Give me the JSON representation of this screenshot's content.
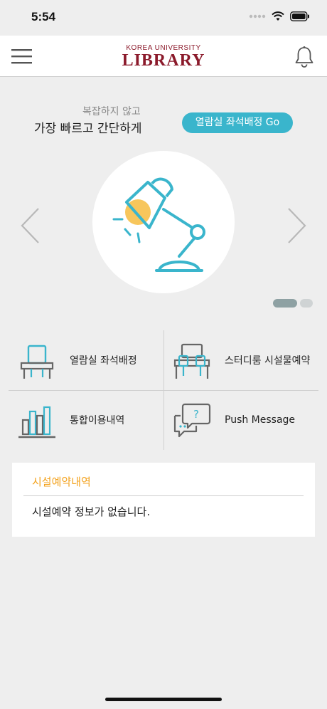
{
  "status_bar": {
    "time": "5:54"
  },
  "header": {
    "logo_sub": "KOREA UNIVERSITY",
    "logo_main": "LIBRARY",
    "menu_icon": "hamburger-menu-icon",
    "notification_icon": "bell-icon"
  },
  "hero": {
    "tagline_line1": "복잡하지 않고",
    "tagline_line2": "가장 빠르고 간단하게",
    "go_button": "열람실 좌석배정 Go",
    "illustration": "desk-lamp-icon",
    "carousel_pages": 2,
    "carousel_active_page": 1
  },
  "menu": {
    "items": [
      {
        "label": "열람실 좌석배정",
        "icon": "reading-room-seat-icon"
      },
      {
        "label": "스터디룸 시설물예약",
        "icon": "study-room-icon"
      },
      {
        "label": "통합이용내역",
        "icon": "bar-chart-icon"
      },
      {
        "label": "Push Message",
        "icon": "chat-bubble-icon"
      }
    ]
  },
  "reservation": {
    "title": "시설예약내역",
    "empty_message": "시설예약 정보가 없습니다."
  },
  "colors": {
    "accent_teal": "#3ab5cc",
    "brand_crimson": "#8b1a2b",
    "title_orange": "#f3a21d",
    "lamp_yellow": "#f6c04a"
  }
}
